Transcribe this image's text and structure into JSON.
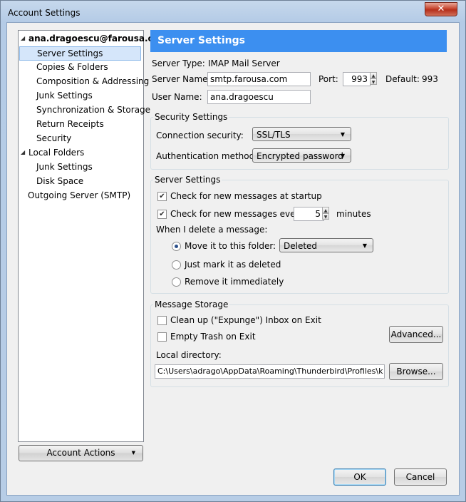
{
  "window": {
    "title": "Account Settings",
    "close_glyph": "✕"
  },
  "tree": {
    "items": [
      {
        "label": "ana.dragoescu@farousa.com",
        "bold": true
      },
      {
        "label": "Server Settings",
        "selected": true
      },
      {
        "label": "Copies & Folders"
      },
      {
        "label": "Composition & Addressing"
      },
      {
        "label": "Junk Settings"
      },
      {
        "label": "Synchronization & Storage"
      },
      {
        "label": "Return Receipts"
      },
      {
        "label": "Security"
      },
      {
        "label": "Local Folders"
      },
      {
        "label": "Junk Settings"
      },
      {
        "label": "Disk Space"
      },
      {
        "label": "Outgoing Server (SMTP)"
      }
    ],
    "account_actions_label": "Account Actions"
  },
  "panel": {
    "header": "Server Settings",
    "server_type_label": "Server Type:",
    "server_type_value": "IMAP Mail Server",
    "server_name_label": "Server Name:",
    "server_name_value": "smtp.farousa.com",
    "port_label": "Port:",
    "port_value": "993",
    "default_label": "Default:",
    "default_value": "993",
    "user_name_label": "User Name:",
    "user_name_value": "ana.dragoescu"
  },
  "security": {
    "title": "Security Settings",
    "connection_label": "Connection security:",
    "connection_value": "SSL/TLS",
    "auth_label": "Authentication method:",
    "auth_value": "Encrypted password"
  },
  "server_settings": {
    "title": "Server Settings",
    "check_startup_label": "Check for new messages at startup",
    "check_every_label": "Check for new messages every",
    "check_every_value": "5",
    "minutes_label": "minutes",
    "delete_label": "When I delete a message:",
    "move_label": "Move it to this folder:",
    "folder_value": "Deleted",
    "mark_label": "Just mark it as deleted",
    "remove_label": "Remove it immediately"
  },
  "storage": {
    "title": "Message Storage",
    "cleanup_label": "Clean up (\"Expunge\") Inbox on Exit",
    "empty_trash_label": "Empty Trash on Exit",
    "advanced_label": "Advanced...",
    "local_dir_label": "Local directory:",
    "local_dir_value": "C:\\Users\\adrago\\AppData\\Roaming\\Thunderbird\\Profiles\\k",
    "browse_label": "Browse..."
  },
  "footer": {
    "ok_label": "OK",
    "cancel_label": "Cancel"
  }
}
